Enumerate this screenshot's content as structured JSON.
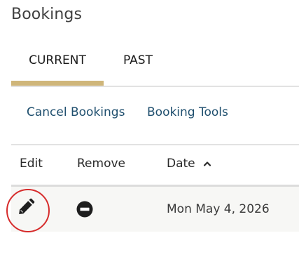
{
  "page": {
    "title": "Bookings"
  },
  "tabs": [
    {
      "label": "CURRENT",
      "selected": true
    },
    {
      "label": "PAST",
      "selected": false
    }
  ],
  "accent_color": "#cfb67a",
  "link_color": "#1f4f6e",
  "highlight_color": "#d62b2b",
  "tools": {
    "cancel_label": "Cancel Bookings",
    "booking_tools_label": "Booking Tools"
  },
  "table": {
    "columns": [
      "Edit",
      "Remove",
      "Date"
    ],
    "sort": {
      "column": "Date",
      "icon": "chevron-up-icon"
    },
    "rows": [
      {
        "edit_icon": "pencil-icon",
        "remove_icon": "minus-circle-icon",
        "date": "Mon May 4, 2026"
      }
    ]
  }
}
